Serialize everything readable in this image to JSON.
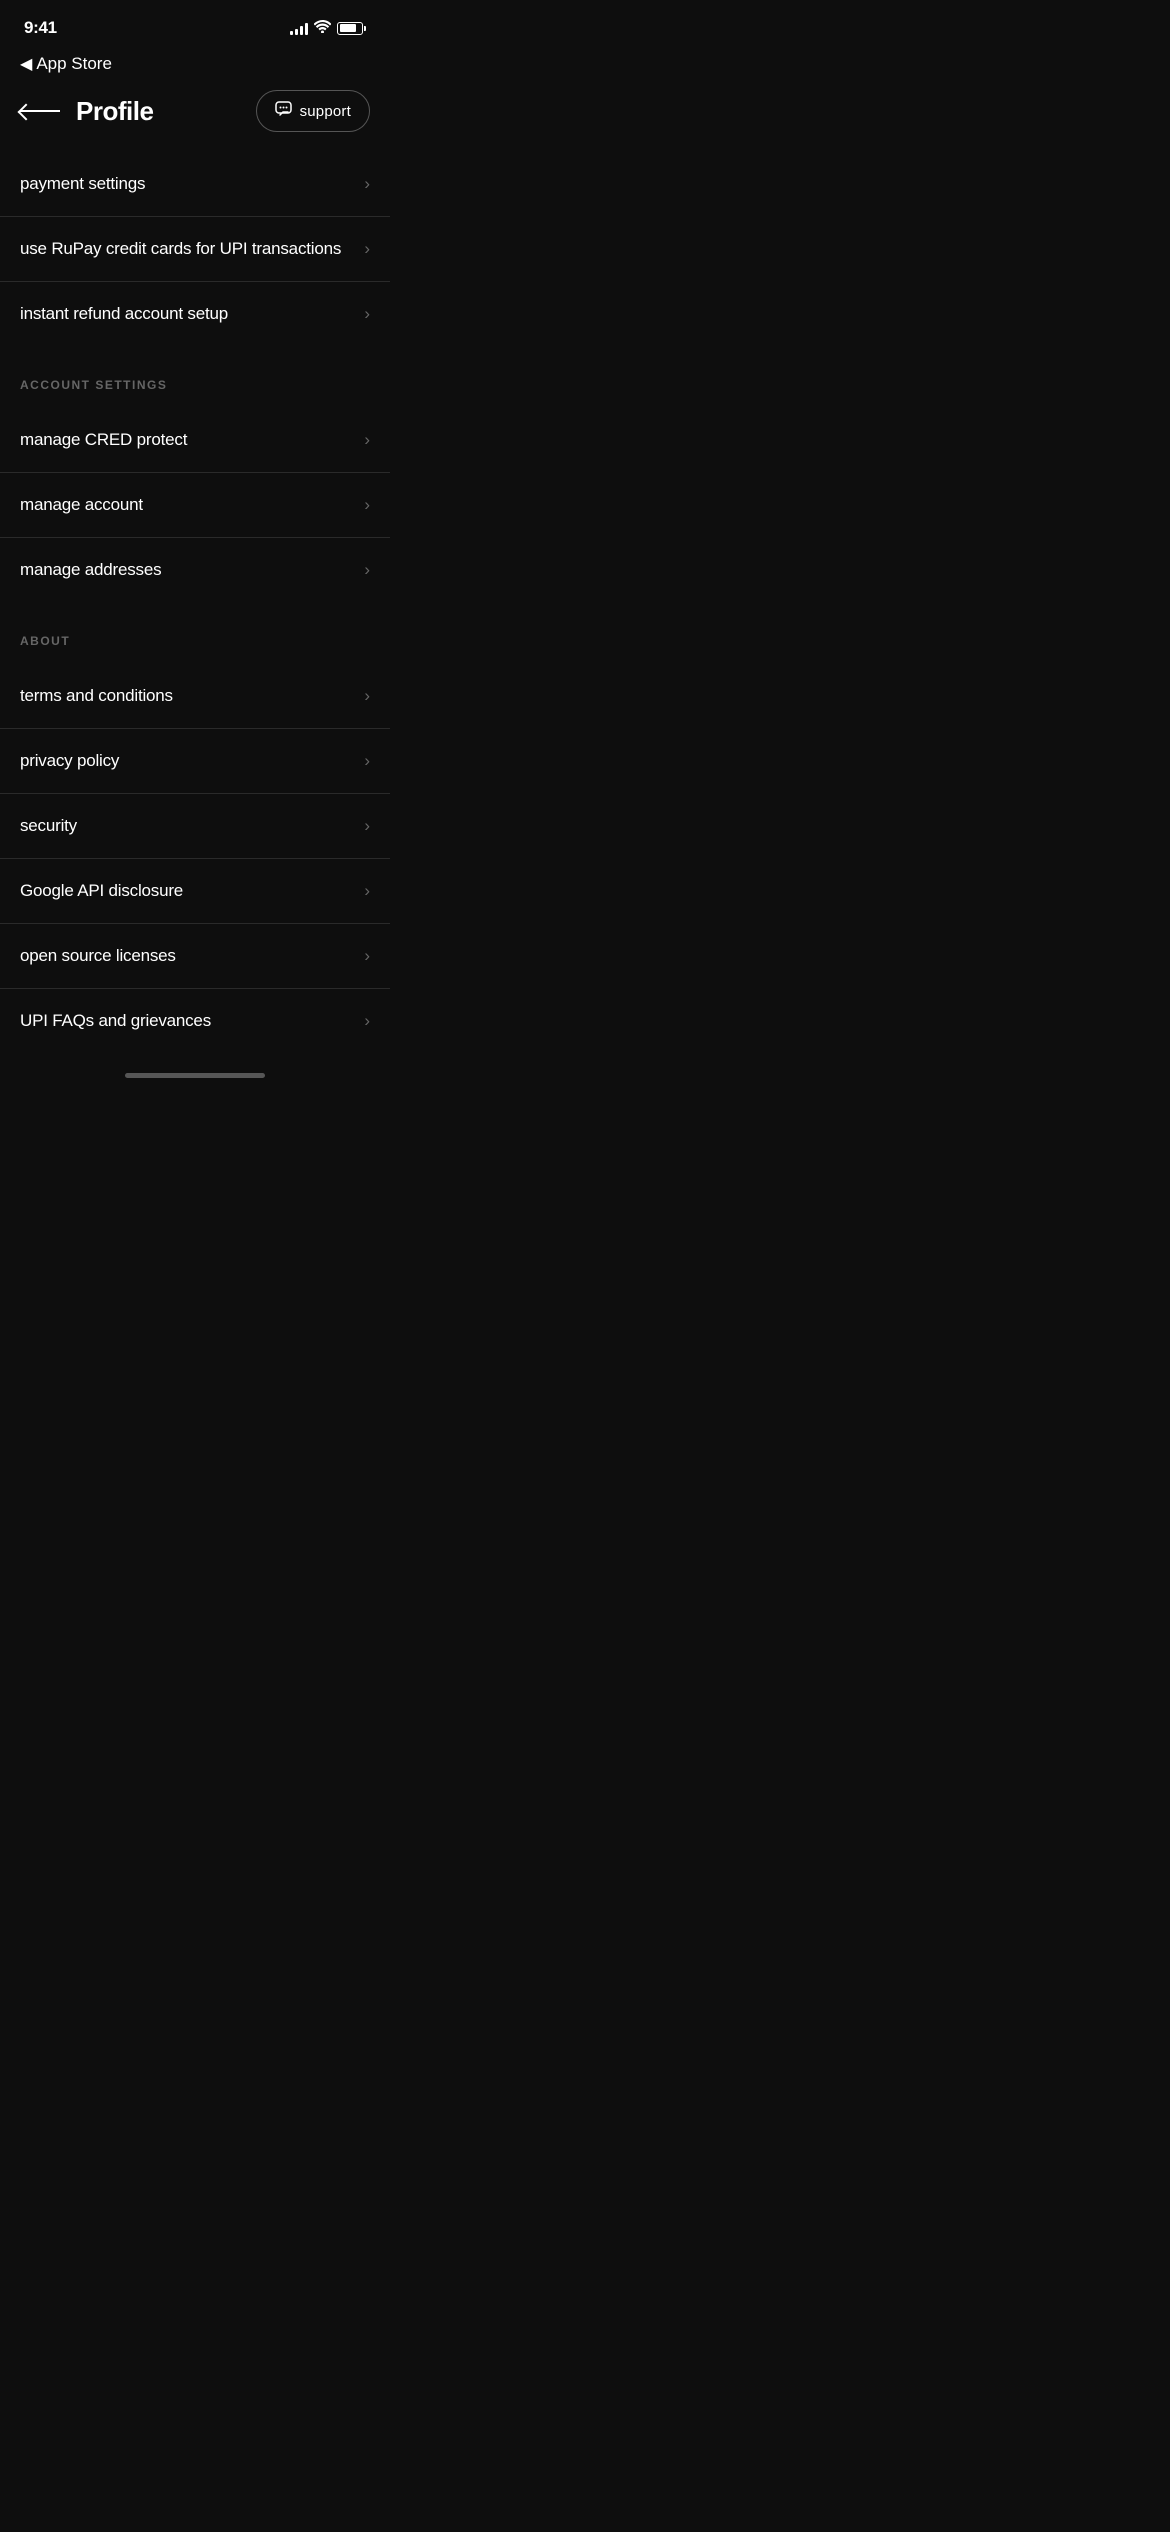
{
  "statusBar": {
    "time": "9:41",
    "appStoreBack": "◀ App Store"
  },
  "header": {
    "title": "Profile",
    "supportLabel": "support"
  },
  "paymentSection": {
    "items": [
      {
        "label": "payment settings"
      },
      {
        "label": "use RuPay credit cards for UPI transactions"
      },
      {
        "label": "instant refund account setup"
      }
    ]
  },
  "accountSection": {
    "heading": "ACCOUNT SETTINGS",
    "items": [
      {
        "label": "manage CRED protect"
      },
      {
        "label": "manage account"
      },
      {
        "label": "manage addresses"
      }
    ]
  },
  "aboutSection": {
    "heading": "ABOUT",
    "items": [
      {
        "label": "terms and conditions"
      },
      {
        "label": "privacy policy"
      },
      {
        "label": "security"
      },
      {
        "label": "Google API disclosure"
      },
      {
        "label": "open source licenses"
      },
      {
        "label": "UPI FAQs and grievances"
      }
    ]
  },
  "chevron": "›"
}
